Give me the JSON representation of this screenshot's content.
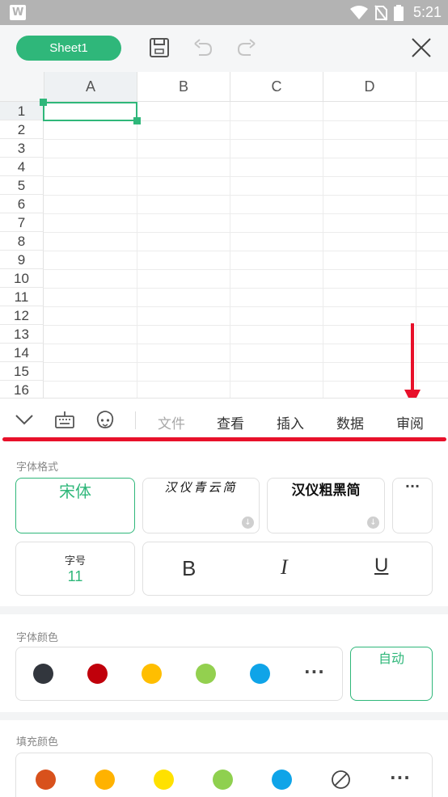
{
  "statusbar": {
    "app_logo": "W",
    "time": "5:21",
    "icons": [
      "wifi-icon",
      "no-sim-icon",
      "battery-icon"
    ]
  },
  "toolbar": {
    "sheet_tab": "Sheet1",
    "icons": [
      "save-icon",
      "undo-icon",
      "redo-icon",
      "close-icon"
    ]
  },
  "grid": {
    "columns": [
      "A",
      "B",
      "C",
      "D"
    ],
    "rows": [
      "1",
      "2",
      "3",
      "4",
      "5",
      "6",
      "7",
      "8",
      "9",
      "10",
      "11",
      "12",
      "13",
      "14",
      "15",
      "16"
    ],
    "selected_cell": "A1"
  },
  "tabbar": {
    "icons": [
      "collapse-chevron-icon",
      "keyboard-icon",
      "emoji-icon"
    ],
    "tabs": [
      "文件",
      "查看",
      "插入",
      "数据",
      "审阅"
    ],
    "disabled_tab": "文件"
  },
  "panel": {
    "font_format": {
      "title": "字体格式",
      "fonts": [
        "宋体",
        "汉仪青云简",
        "汉仪粗黑简"
      ],
      "more": "···",
      "size_label": "字号",
      "size_value": "11",
      "bold": "B",
      "italic": "I",
      "underline": "U"
    },
    "font_color": {
      "title": "字体颜色",
      "colors": [
        "#32363d",
        "#c0000b",
        "#ffbe00",
        "#93d04f",
        "#0fa4e8"
      ],
      "auto_label": "自动"
    },
    "fill_color": {
      "title": "填充颜色",
      "colors": [
        "#d8511c",
        "#ffb200",
        "#ffe100",
        "#8fd04f",
        "#0fa4e8"
      ],
      "no_fill_icon": "no-fill-icon"
    }
  },
  "accent_color": "#2fb77a",
  "annotation_color": "#e8102a"
}
